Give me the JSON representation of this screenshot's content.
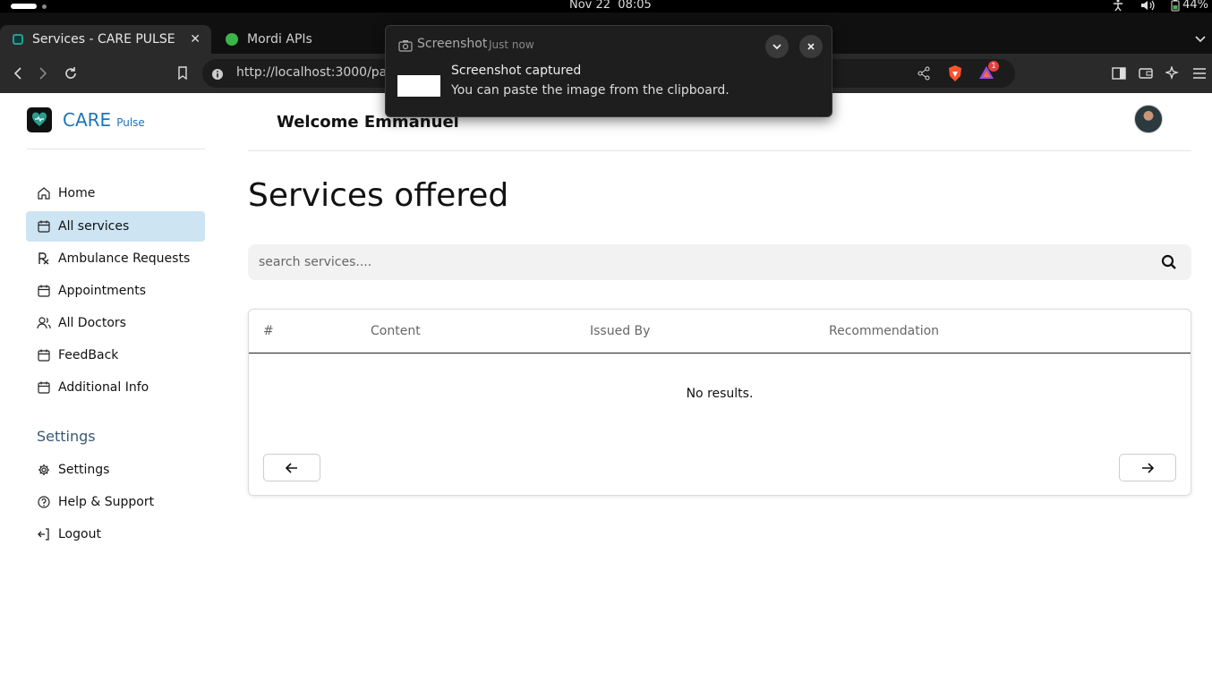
{
  "os": {
    "clock": "Nov 22  08:05",
    "battery": "44%"
  },
  "browser": {
    "tabs": [
      {
        "title": "Services - CARE PULSE",
        "favicon_color": "#2a9d8f"
      },
      {
        "title": "Mordi APIs",
        "favicon_color": "#3bb54a"
      }
    ],
    "url": "http://localhost:3000/patie",
    "brave_badge": "1"
  },
  "app": {
    "logo": {
      "name": "CARE",
      "sub": "Pulse"
    },
    "nav": [
      {
        "label": "Home",
        "icon": "home-icon"
      },
      {
        "label": "All services",
        "icon": "calendar-icon",
        "active": true
      },
      {
        "label": "Ambulance Requests",
        "icon": "rx-icon"
      },
      {
        "label": "Appointments",
        "icon": "calendar-icon"
      },
      {
        "label": "All Doctors",
        "icon": "users-icon"
      },
      {
        "label": "FeedBack",
        "icon": "calendar-icon"
      },
      {
        "label": "Additional Info",
        "icon": "calendar-icon"
      }
    ],
    "settings_heading": "Settings",
    "settings_nav": [
      {
        "label": "Settings",
        "icon": "gear-icon"
      },
      {
        "label": "Help & Support",
        "icon": "help-icon"
      },
      {
        "label": "Logout",
        "icon": "logout-icon"
      }
    ],
    "welcome": "Welcome Emmanuel",
    "page_title": "Services offered",
    "search": {
      "placeholder": "search services....",
      "value": ""
    },
    "table": {
      "columns": [
        "#",
        "Content",
        "Issued By",
        "Recommendation"
      ],
      "empty_text": "No results."
    }
  },
  "notification": {
    "app": "Screenshot",
    "time": "Just now",
    "title": "Screenshot captured",
    "body": "You can paste the image from the clipboard."
  }
}
